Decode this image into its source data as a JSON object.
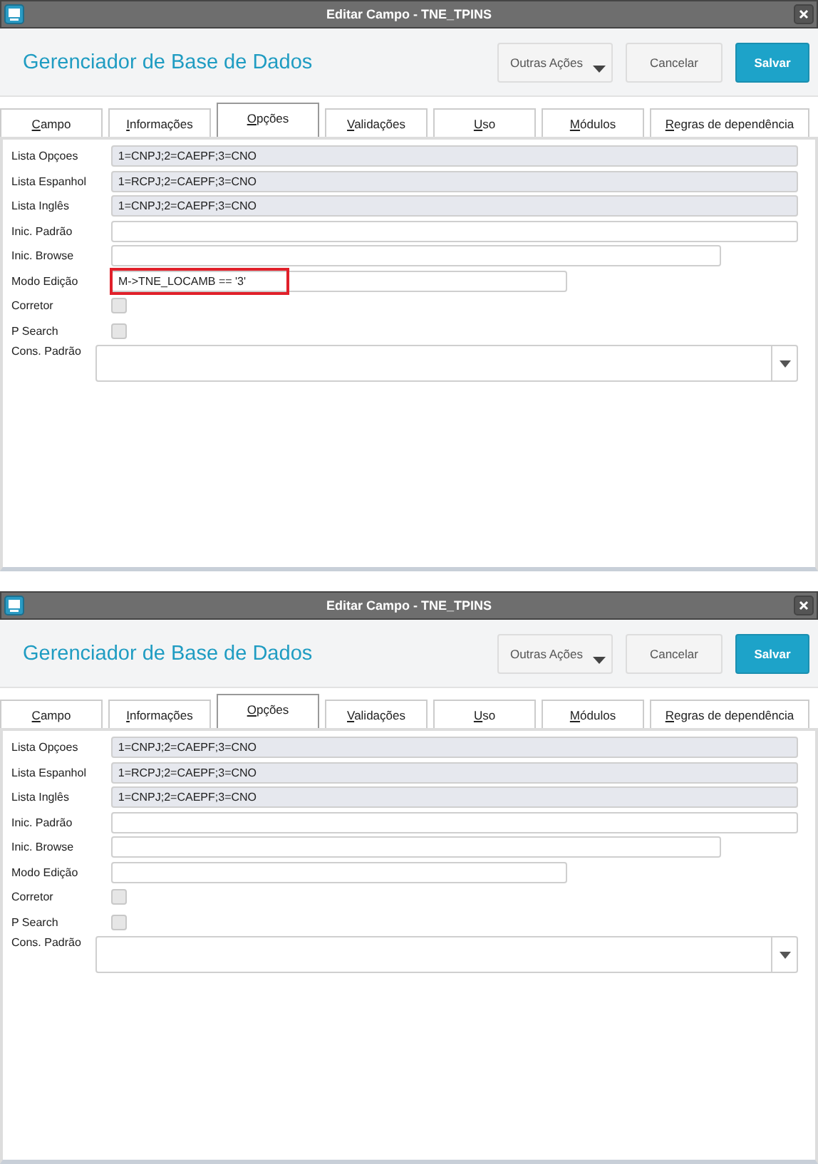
{
  "windows": [
    {
      "title": "Editar Campo - TNE_TPINS",
      "header": "Gerenciador de Base de Dados",
      "buttons": [
        {
          "label": "Outras Ações",
          "kind": "menu"
        },
        {
          "label": "Cancelar",
          "kind": "plain"
        },
        {
          "label": "Salvar",
          "kind": "primary"
        }
      ],
      "tabs": [
        {
          "label": "Campo",
          "selected": false
        },
        {
          "label": "Informações",
          "selected": false
        },
        {
          "label": "Opções",
          "selected": true
        },
        {
          "label": "Validações",
          "selected": false
        },
        {
          "label": "Uso",
          "selected": false
        },
        {
          "label": "Módulos",
          "selected": false
        },
        {
          "label": "Regras de dependência",
          "selected": false
        }
      ],
      "fields": [
        {
          "label": "Lista Opçoes",
          "kind": "readonly",
          "value": "1=CNPJ;2=CAEPF;3=CNO",
          "highlighted": false
        },
        {
          "label": "Lista Espanhol",
          "kind": "readonly",
          "value": "1=RCPJ;2=CAEPF;3=CNO",
          "highlighted": false
        },
        {
          "label": "Lista Inglês",
          "kind": "readonly",
          "value": "1=CNPJ;2=CAEPF;3=CNO",
          "highlighted": false
        },
        {
          "label": "Inic. Padrão",
          "kind": "text",
          "highlighted": false
        },
        {
          "label": "Inic. Browse",
          "kind": "text",
          "highlighted": false
        },
        {
          "label": "Modo Edição",
          "kind": "text",
          "value": "M->TNE_LOCAMB == '3'",
          "highlighted": true
        },
        {
          "label": "Corretor",
          "kind": "checkbox",
          "checked": false
        },
        {
          "label": "P Search",
          "kind": "checkbox",
          "checked": false
        },
        {
          "label": "Cons. Padrão",
          "kind": "combo"
        }
      ]
    },
    {
      "title": "Editar Campo - TNE_TPINS",
      "header": "Gerenciador de Base de Dados",
      "buttons": [
        {
          "label": "Outras Ações",
          "kind": "menu"
        },
        {
          "label": "Cancelar",
          "kind": "plain"
        },
        {
          "label": "Salvar",
          "kind": "primary"
        }
      ],
      "tabs": [
        {
          "label": "Campo",
          "selected": false
        },
        {
          "label": "Informações",
          "selected": false
        },
        {
          "label": "Opções",
          "selected": true
        },
        {
          "label": "Validações",
          "selected": false
        },
        {
          "label": "Uso",
          "selected": false
        },
        {
          "label": "Módulos",
          "selected": false
        },
        {
          "label": "Regras de dependência",
          "selected": false
        }
      ],
      "fields": [
        {
          "label": "Lista Opçoes",
          "kind": "readonly",
          "value": "1=CNPJ;2=CAEPF;3=CNO",
          "highlighted": false
        },
        {
          "label": "Lista Espanhol",
          "kind": "readonly",
          "value": "1=RCPJ;2=CAEPF;3=CNO",
          "highlighted": false
        },
        {
          "label": "Lista Inglês",
          "kind": "readonly",
          "value": "1=CNPJ;2=CAEPF;3=CNO",
          "highlighted": false
        },
        {
          "label": "Inic. Padrão",
          "kind": "text",
          "highlighted": false
        },
        {
          "label": "Inic. Browse",
          "kind": "text",
          "highlighted": false
        },
        {
          "label": "Modo Edição",
          "kind": "text",
          "highlighted": false
        },
        {
          "label": "Corretor",
          "kind": "checkbox",
          "checked": false
        },
        {
          "label": "P Search",
          "kind": "checkbox",
          "checked": false
        },
        {
          "label": "Cons. Padrão",
          "kind": "combo"
        }
      ]
    }
  ]
}
